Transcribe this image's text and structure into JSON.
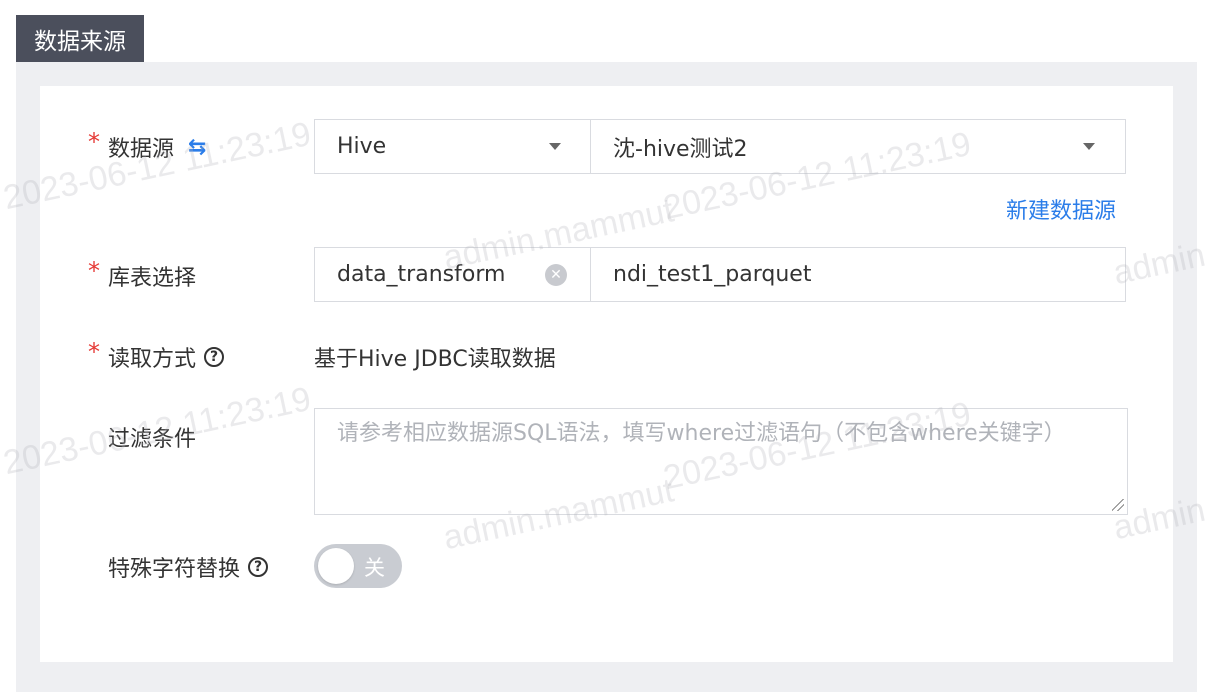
{
  "section": {
    "title": "数据来源"
  },
  "form": {
    "datasource": {
      "label": "数据源",
      "swap_icon": "swap-arrows-icon",
      "type_value": "Hive",
      "instance_value": "沈-hive测试2",
      "new_link": "新建数据源"
    },
    "table_select": {
      "label": "库表选择",
      "database_value": "data_transform",
      "table_value": "ndi_test1_parquet"
    },
    "read_mode": {
      "label": "读取方式",
      "value": "基于Hive JDBC读取数据"
    },
    "filter": {
      "label": "过滤条件",
      "placeholder": "请参考相应数据源SQL语法，填写where过滤语句（不包含where关键字）"
    },
    "special_char": {
      "label": "特殊字符替换",
      "toggle_text": "关",
      "enabled": false
    }
  },
  "watermark": {
    "user": "admin.mammut",
    "timestamp": "2023-06-12 11:23:19"
  },
  "colors": {
    "accent": "#2b7de9",
    "required": "#e53935",
    "tag_bg": "#4b4f5c"
  }
}
